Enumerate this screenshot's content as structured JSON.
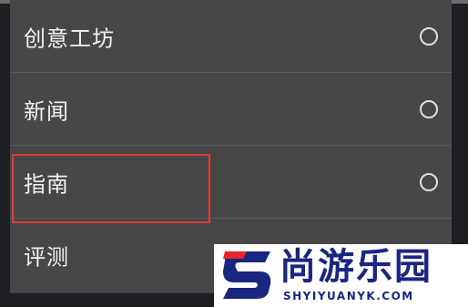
{
  "options": [
    {
      "label": "创意工坊",
      "selected": false
    },
    {
      "label": "新闻",
      "selected": false
    },
    {
      "label": "指南",
      "selected": false
    },
    {
      "label": "评测",
      "selected": false
    }
  ],
  "watermark": {
    "title": "尚游乐园",
    "url": "SHYIYUANYK.COM"
  },
  "colors": {
    "panel": "#474747",
    "text": "#f2f2f2",
    "highlight": "#e03a3a",
    "watermark_brand": "#1a2680",
    "watermark_accent": "#e8232a"
  }
}
